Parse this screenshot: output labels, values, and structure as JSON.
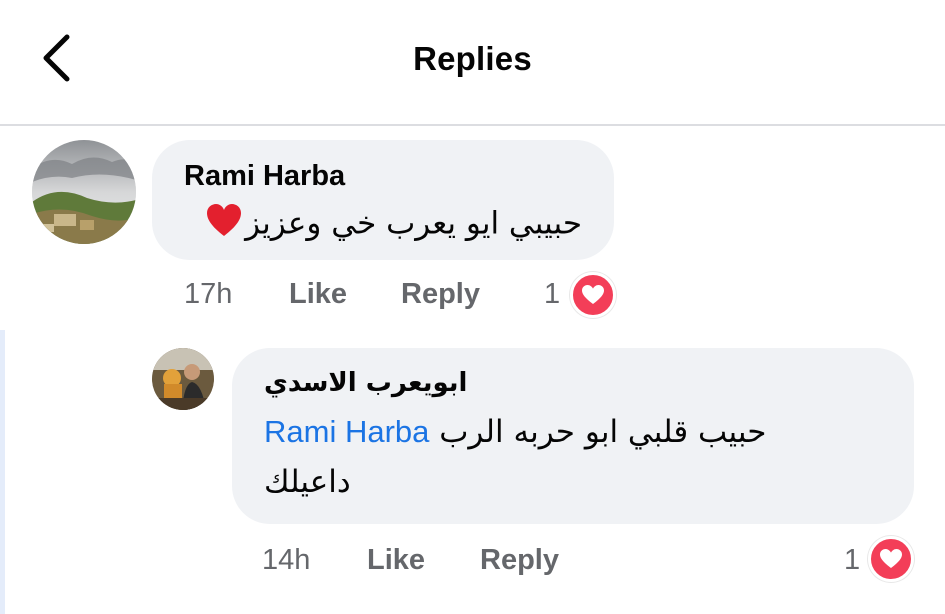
{
  "header": {
    "title": "Replies"
  },
  "comment": {
    "author": "Rami Harba",
    "text": "حبيبي ايو يعرب خي وعزيز",
    "emoji": "❤️",
    "time": "17h",
    "like_label": "Like",
    "reply_label": "Reply",
    "reaction_count": "1"
  },
  "reply": {
    "author": "ابويعرب الاسدي",
    "text_line1_prefix": "حبيب قلبي ابو حربه الرب",
    "mention": "Rami Harba",
    "text_line2": "داعيلك",
    "time": "14h",
    "like_label": "Like",
    "reply_label": "Reply",
    "reaction_count": "1"
  },
  "colors": {
    "bubble": "#f0f2f5",
    "mention": "#1b74e4",
    "heart": "#f33e58",
    "meta": "#65676b"
  }
}
